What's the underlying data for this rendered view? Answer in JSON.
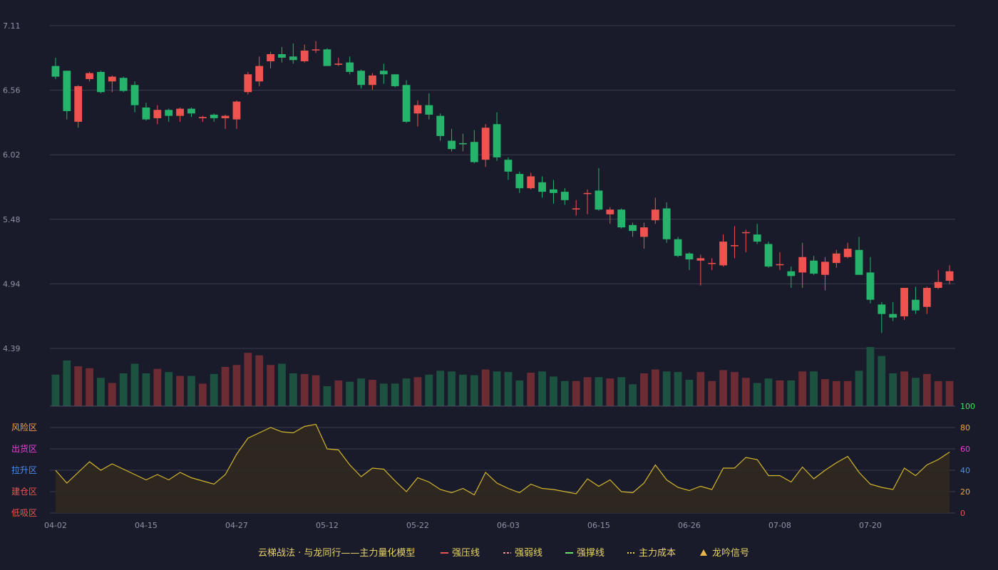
{
  "chart_data": {
    "type": "candlestick",
    "price_axis": {
      "ticks": [
        "7.11",
        "6.56",
        "6.02",
        "5.48",
        "4.94",
        "4.39"
      ],
      "ylim": [
        4.39,
        7.11
      ]
    },
    "indicator_axis": {
      "ticks": [
        "100",
        "80",
        "60",
        "40",
        "20",
        "0"
      ],
      "ylim": [
        0,
        100
      ]
    },
    "zones": [
      {
        "label": "风险区",
        "level": 80,
        "color": "#f2a340"
      },
      {
        "label": "出货区",
        "level": 60,
        "color": "#ef3fd8"
      },
      {
        "label": "拉升区",
        "level": 40,
        "color": "#4d8ef0"
      },
      {
        "label": "建仓区",
        "level": 20,
        "color": "#ef5350"
      },
      {
        "label": "低吸区",
        "level": 0,
        "color": "#ef5350"
      }
    ],
    "x_ticks": [
      "04-02",
      "04-15",
      "04-27",
      "05-12",
      "05-22",
      "06-03",
      "06-15",
      "06-26",
      "07-08",
      "07-20"
    ],
    "x_tick_index": [
      0,
      8,
      16,
      24,
      32,
      40,
      48,
      56,
      64,
      72
    ],
    "candles": [
      [
        6.77,
        6.68,
        6.84,
        6.66
      ],
      [
        6.73,
        6.39,
        6.73,
        6.32
      ],
      [
        6.3,
        6.6,
        6.61,
        6.25
      ],
      [
        6.66,
        6.71,
        6.72,
        6.64
      ],
      [
        6.72,
        6.55,
        6.73,
        6.54
      ],
      [
        6.64,
        6.68,
        6.69,
        6.55
      ],
      [
        6.67,
        6.56,
        6.68,
        6.55
      ],
      [
        6.61,
        6.44,
        6.64,
        6.38
      ],
      [
        6.42,
        6.32,
        6.46,
        6.31
      ],
      [
        6.33,
        6.4,
        6.44,
        6.28
      ],
      [
        6.4,
        6.35,
        6.41,
        6.3
      ],
      [
        6.35,
        6.41,
        6.42,
        6.3
      ],
      [
        6.41,
        6.37,
        6.42,
        6.34
      ],
      [
        6.33,
        6.34,
        6.35,
        6.3
      ],
      [
        6.36,
        6.33,
        6.37,
        6.3
      ],
      [
        6.33,
        6.35,
        6.36,
        6.24
      ],
      [
        6.32,
        6.47,
        6.48,
        6.24
      ],
      [
        6.55,
        6.7,
        6.72,
        6.53
      ],
      [
        6.64,
        6.77,
        6.85,
        6.6
      ],
      [
        6.81,
        6.87,
        6.89,
        6.75
      ],
      [
        6.87,
        6.84,
        6.93,
        6.8
      ],
      [
        6.85,
        6.82,
        6.96,
        6.79
      ],
      [
        6.81,
        6.9,
        6.95,
        6.8
      ],
      [
        6.91,
        6.91,
        6.98,
        6.88
      ],
      [
        6.91,
        6.77,
        6.92,
        6.77
      ],
      [
        6.78,
        6.79,
        6.84,
        6.77
      ],
      [
        6.8,
        6.72,
        6.85,
        6.7
      ],
      [
        6.73,
        6.61,
        6.74,
        6.58
      ],
      [
        6.61,
        6.69,
        6.71,
        6.57
      ],
      [
        6.73,
        6.7,
        6.79,
        6.62
      ],
      [
        6.7,
        6.6,
        6.7,
        6.59
      ],
      [
        6.61,
        6.3,
        6.65,
        6.29
      ],
      [
        6.37,
        6.44,
        6.48,
        6.26
      ],
      [
        6.44,
        6.36,
        6.54,
        6.32
      ],
      [
        6.35,
        6.18,
        6.37,
        6.14
      ],
      [
        6.14,
        6.07,
        6.24,
        6.05
      ],
      [
        6.12,
        6.11,
        6.2,
        6.05
      ],
      [
        6.13,
        5.96,
        6.23,
        5.95
      ],
      [
        5.98,
        6.25,
        6.28,
        5.92
      ],
      [
        6.28,
        6.0,
        6.38,
        5.97
      ],
      [
        5.98,
        5.88,
        6.0,
        5.81
      ],
      [
        5.86,
        5.74,
        5.88,
        5.7
      ],
      [
        5.74,
        5.84,
        5.87,
        5.73
      ],
      [
        5.79,
        5.71,
        5.84,
        5.66
      ],
      [
        5.73,
        5.7,
        5.81,
        5.61
      ],
      [
        5.71,
        5.64,
        5.74,
        5.6
      ],
      [
        5.57,
        5.57,
        5.64,
        5.51
      ],
      [
        5.7,
        5.7,
        5.73,
        5.52
      ],
      [
        5.72,
        5.56,
        5.91,
        5.55
      ],
      [
        5.52,
        5.56,
        5.58,
        5.44
      ],
      [
        5.56,
        5.41,
        5.57,
        5.4
      ],
      [
        5.43,
        5.38,
        5.45,
        5.33
      ],
      [
        5.33,
        5.41,
        5.45,
        5.23
      ],
      [
        5.47,
        5.56,
        5.66,
        5.44
      ],
      [
        5.57,
        5.31,
        5.62,
        5.28
      ],
      [
        5.31,
        5.17,
        5.33,
        5.16
      ],
      [
        5.19,
        5.14,
        5.2,
        5.05
      ],
      [
        5.13,
        5.15,
        5.18,
        4.92
      ],
      [
        5.11,
        5.11,
        5.15,
        5.05
      ],
      [
        5.09,
        5.29,
        5.35,
        5.08
      ],
      [
        5.26,
        5.26,
        5.42,
        5.15
      ],
      [
        5.37,
        5.37,
        5.39,
        5.2
      ],
      [
        5.35,
        5.29,
        5.44,
        5.27
      ],
      [
        5.27,
        5.08,
        5.29,
        5.07
      ],
      [
        5.1,
        5.1,
        5.2,
        5.05
      ],
      [
        5.04,
        5.0,
        5.08,
        4.9
      ],
      [
        5.03,
        5.16,
        5.28,
        4.9
      ],
      [
        5.13,
        5.02,
        5.17,
        5.01
      ],
      [
        5.01,
        5.12,
        5.16,
        4.88
      ],
      [
        5.11,
        5.19,
        5.22,
        5.07
      ],
      [
        5.16,
        5.23,
        5.28,
        5.15
      ],
      [
        5.22,
        5.01,
        5.33,
        5.01
      ],
      [
        5.03,
        4.8,
        5.16,
        4.77
      ],
      [
        4.76,
        4.68,
        4.78,
        4.52
      ],
      [
        4.68,
        4.65,
        4.78,
        4.62
      ],
      [
        4.66,
        4.9,
        4.9,
        4.63
      ],
      [
        4.8,
        4.71,
        4.91,
        4.68
      ],
      [
        4.74,
        4.9,
        4.91,
        4.68
      ],
      [
        4.9,
        4.95,
        5.05,
        4.89
      ],
      [
        4.96,
        5.04,
        5.09,
        4.93
      ]
    ],
    "volume": [
      49,
      71,
      62,
      59,
      44,
      36,
      51,
      66,
      51,
      58,
      53,
      47,
      47,
      35,
      50,
      61,
      64,
      83,
      79,
      64,
      66,
      51,
      50,
      48,
      31,
      40,
      38,
      43,
      41,
      35,
      35,
      43,
      45,
      49,
      55,
      54,
      49,
      48,
      57,
      54,
      53,
      40,
      52,
      54,
      46,
      39,
      39,
      45,
      45,
      43,
      45,
      34,
      51,
      57,
      54,
      53,
      41,
      53,
      39,
      56,
      53,
      44,
      36,
      43,
      40,
      40,
      54,
      54,
      42,
      39,
      39,
      55,
      92,
      78,
      51,
      54,
      44,
      50,
      39,
      39
    ],
    "indicator": [
      40,
      28,
      38,
      48,
      40,
      46,
      41,
      36,
      31,
      36,
      31,
      38,
      33,
      30,
      27,
      36,
      55,
      70,
      75,
      80,
      76,
      75,
      81,
      83,
      60,
      59,
      45,
      34,
      42,
      41,
      30,
      20,
      33,
      29,
      22,
      19,
      23,
      17,
      38,
      28,
      23,
      19,
      27,
      23,
      22,
      20,
      18,
      32,
      25,
      31,
      20,
      19,
      28,
      45,
      31,
      24,
      21,
      25,
      22,
      42,
      42,
      52,
      50,
      35,
      35,
      29,
      43,
      32,
      40,
      47,
      53,
      38,
      27,
      24,
      22,
      42,
      35,
      45,
      50,
      57
    ],
    "legend": [
      {
        "label": "云梯战法 · 与龙同行——主力量化模型",
        "color": "#e8d36a"
      },
      {
        "label": "强压线",
        "color": "#ef5350"
      },
      {
        "label": "强弱线",
        "color": "#f28b8b"
      },
      {
        "label": "强撑线",
        "color": "#6ae06a"
      },
      {
        "label": "主力成本",
        "color": "#e8d36a"
      },
      {
        "label": "龙吟信号",
        "color": "#e8b84a"
      }
    ],
    "colors": {
      "up": "#ef5350",
      "down": "#26b36b",
      "vol_up": "#6b2c34",
      "vol_down": "#1e5240",
      "indicator_line": "#d4b62c",
      "indicator_fill": "#30291f",
      "axis_top": "#3fe36a"
    }
  }
}
